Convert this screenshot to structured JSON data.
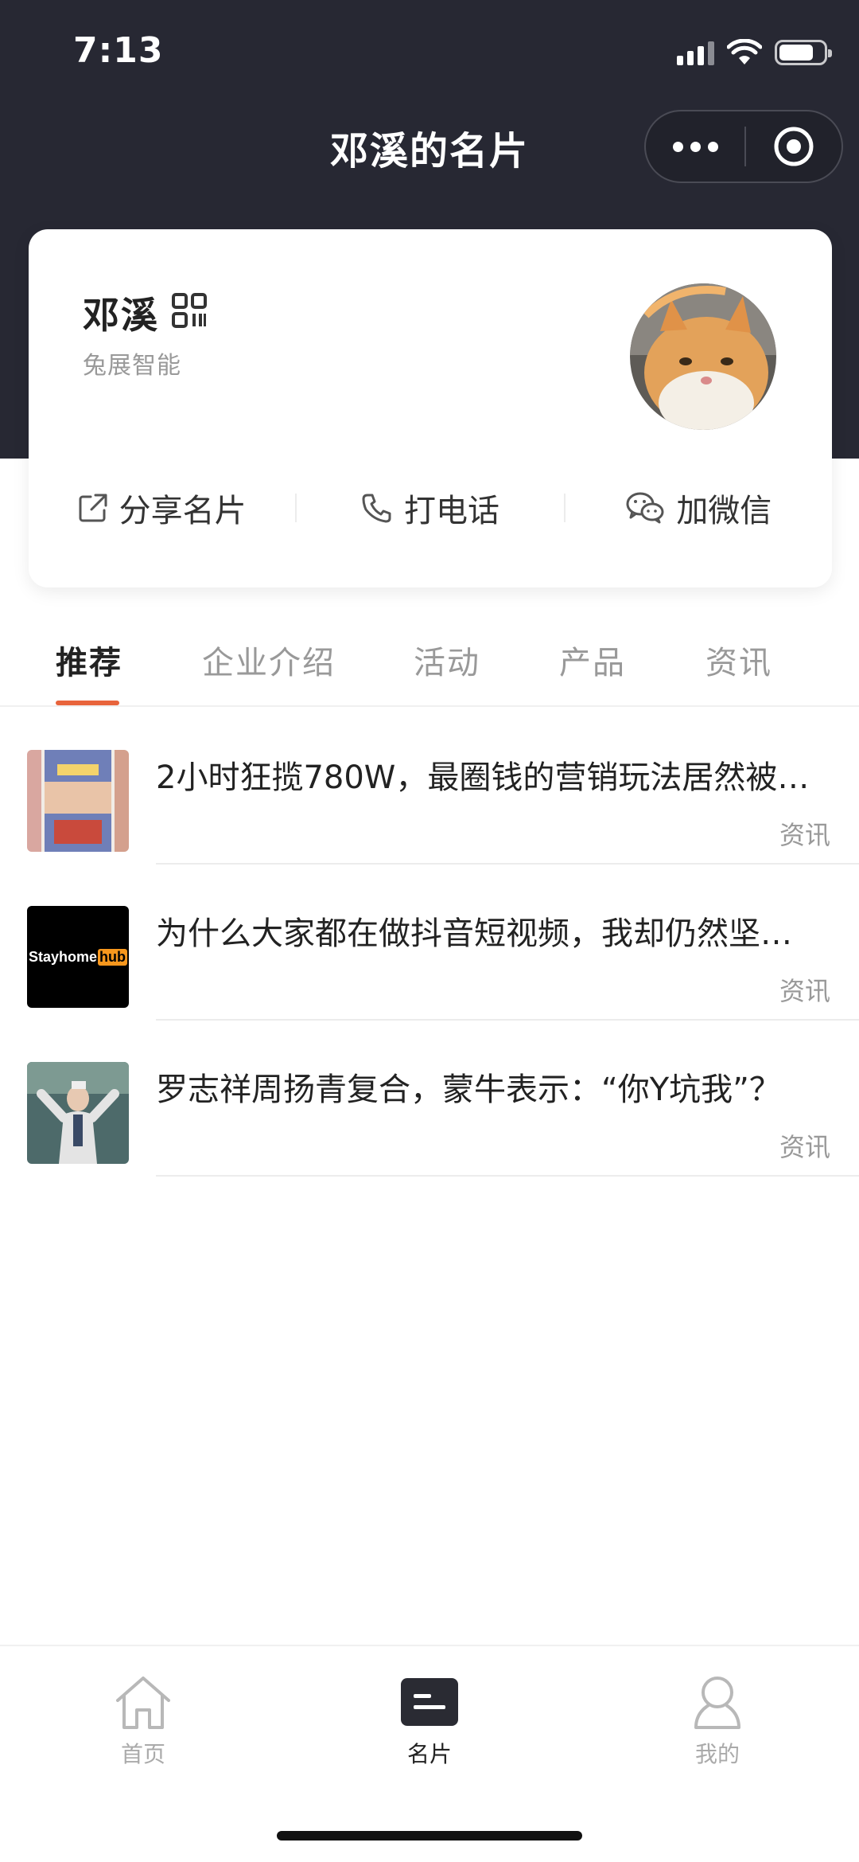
{
  "status": {
    "time": "7:13"
  },
  "nav": {
    "title": "邓溪的名片"
  },
  "card": {
    "name": "邓溪",
    "company": "兔展智能",
    "actions": [
      {
        "label": "分享名片",
        "icon": "share-icon"
      },
      {
        "label": "打电话",
        "icon": "phone-icon"
      },
      {
        "label": "加微信",
        "icon": "wechat-icon"
      }
    ]
  },
  "tabs": [
    {
      "label": "推荐",
      "active": true
    },
    {
      "label": "企业介绍",
      "active": false
    },
    {
      "label": "活动",
      "active": false
    },
    {
      "label": "产品",
      "active": false
    },
    {
      "label": "资讯",
      "active": false
    }
  ],
  "articles": [
    {
      "title": "2小时狂揽780W，最圈钱的营销玩法居然被…",
      "tag": "资讯",
      "thumb_text": ""
    },
    {
      "title": "为什么大家都在做抖音短视频，我却仍然坚…",
      "tag": "资讯",
      "thumb_text": "Stayhome",
      "thumb_badge": "hub"
    },
    {
      "title": "罗志祥周扬青复合，蒙牛表示：“你Y坑我”？",
      "tag": "资讯",
      "thumb_text": ""
    }
  ],
  "tabbar": [
    {
      "label": "首页",
      "icon": "home-icon",
      "active": false
    },
    {
      "label": "名片",
      "icon": "card-icon",
      "active": true
    },
    {
      "label": "我的",
      "icon": "user-icon",
      "active": false
    }
  ],
  "colors": {
    "header_bg": "#272833",
    "accent": "#e8643c"
  }
}
